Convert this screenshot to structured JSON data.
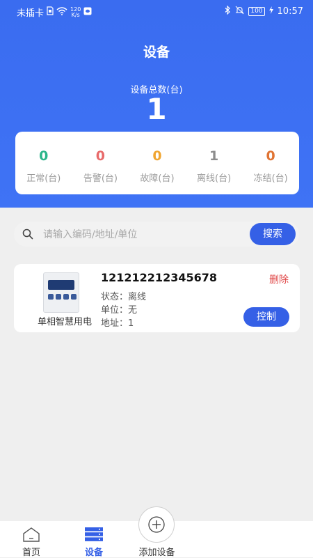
{
  "status_bar": {
    "carrier": "未插卡",
    "speed_value": "120",
    "speed_unit": "K/s",
    "battery": "100",
    "time": "10:57"
  },
  "header": {
    "title": "设备",
    "total_label": "设备总数(台)",
    "total_value": "1"
  },
  "stats": [
    {
      "value": "0",
      "label": "正常(台)",
      "color": "#2bb58a"
    },
    {
      "value": "0",
      "label": "告警(台)",
      "color": "#e86a6a"
    },
    {
      "value": "0",
      "label": "故障(台)",
      "color": "#f0a530"
    },
    {
      "value": "1",
      "label": "离线(台)",
      "color": "#8c8c8c"
    },
    {
      "value": "0",
      "label": "冻结(台)",
      "color": "#e07434"
    }
  ],
  "search": {
    "placeholder": "请输入编码/地址/单位",
    "button_label": "搜索"
  },
  "devices": [
    {
      "type": "单相智慧用电",
      "code": "121212212345678",
      "status_label": "状态：",
      "status_value": "离线",
      "unit_label": "单位：",
      "unit_value": "无",
      "address_label": "地址：",
      "address_value": "1",
      "delete_label": "删除",
      "control_label": "控制"
    }
  ],
  "tabbar": {
    "home_label": "首页",
    "device_label": "设备",
    "add_label": "添加设备",
    "active_color": "#3560e6"
  }
}
